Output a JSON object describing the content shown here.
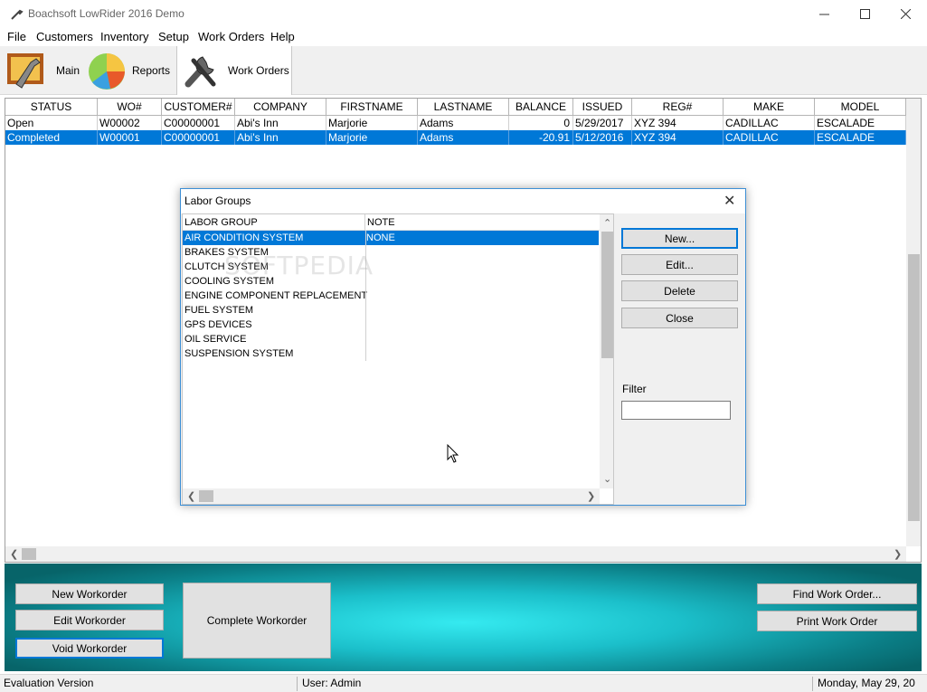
{
  "window": {
    "title": "Boachsoft LowRider 2016 Demo"
  },
  "menu": [
    "File",
    "Customers",
    "Inventory",
    "Setup",
    "Work Orders",
    "Help"
  ],
  "toolbar": {
    "tabs": [
      {
        "label": "Main",
        "icon": "main-icon"
      },
      {
        "label": "Reports",
        "icon": "pie-chart-icon"
      },
      {
        "label": "Work Orders",
        "icon": "wrench-icon"
      }
    ]
  },
  "grid": {
    "columns": [
      "STATUS",
      "WO#",
      "CUSTOMER#",
      "COMPANY",
      "FIRSTNAME",
      "LASTNAME",
      "BALANCE",
      "ISSUED",
      "REG#",
      "MAKE",
      "MODEL"
    ],
    "rows": [
      [
        "Open",
        "W00002",
        "C00000001",
        "Abi's Inn",
        "Marjorie",
        "Adams",
        "0",
        "5/29/2017",
        "XYZ 394",
        "CADILLAC",
        "ESCALADE"
      ],
      [
        "Completed",
        "W00001",
        "C00000001",
        "Abi's Inn",
        "Marjorie",
        "Adams",
        "-20.91",
        "5/12/2016",
        "XYZ 394",
        "CADILLAC",
        "ESCALADE"
      ]
    ]
  },
  "buttons": {
    "new_workorder": "New Workorder",
    "edit_workorder": "Edit Workorder",
    "void_workorder": "Void Workorder",
    "complete_workorder": "Complete Workorder",
    "find_work_order": "Find Work Order...",
    "print_work_order": "Print Work Order"
  },
  "status_bar": {
    "edition": "Evaluation Version",
    "user": "User: Admin",
    "date": "Monday, May 29, 20"
  },
  "dialog": {
    "title": "Labor Groups",
    "columns": [
      "LABOR GROUP",
      "NOTE"
    ],
    "rows": [
      [
        "AIR CONDITION SYSTEM",
        "NONE"
      ],
      [
        "BRAKES SYSTEM",
        ""
      ],
      [
        "CLUTCH SYSTEM",
        ""
      ],
      [
        "COOLING SYSTEM",
        ""
      ],
      [
        "ENGINE COMPONENT REPLACEMENT",
        ""
      ],
      [
        "FUEL SYSTEM",
        ""
      ],
      [
        "GPS DEVICES",
        ""
      ],
      [
        "OIL SERVICE",
        ""
      ],
      [
        "SUSPENSION SYSTEM",
        ""
      ]
    ],
    "buttons": {
      "new": "New...",
      "edit": "Edit...",
      "delete": "Delete",
      "close": "Close"
    },
    "filter_label": "Filter",
    "filter_value": "",
    "watermark": "SOFTPEDIA"
  },
  "colors": {
    "selection": "#0078d7",
    "panel_teal": "#1bbfca"
  }
}
